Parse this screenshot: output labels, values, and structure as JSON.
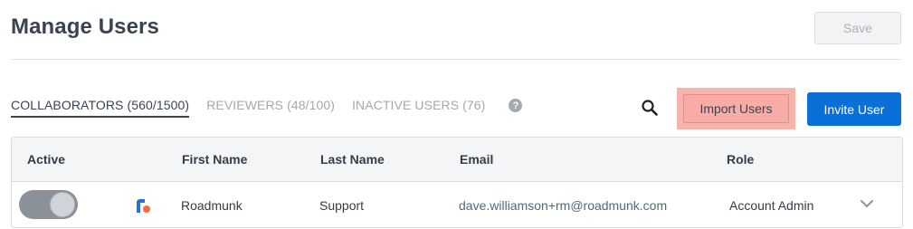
{
  "header": {
    "title": "Manage Users",
    "save_label": "Save"
  },
  "tabs": [
    {
      "label": "COLLABORATORS (560/1500)",
      "active": true
    },
    {
      "label": "REVIEWERS (48/100)",
      "active": false
    },
    {
      "label": "INACTIVE USERS (76)",
      "active": false
    }
  ],
  "help_icon": {
    "glyph": "?",
    "icon": "help-icon"
  },
  "actions": {
    "search_icon": "search-icon",
    "import_label": "Import Users",
    "invite_label": "Invite User"
  },
  "table": {
    "columns": [
      "Active",
      "First Name",
      "Last Name",
      "Email",
      "Role"
    ],
    "rows": [
      {
        "active": true,
        "logo_icon": "roadmunk-logo-icon",
        "first_name": "Roadmunk",
        "last_name": "Support",
        "email": "dave.williamson+rm@roadmunk.com",
        "role": "Account Admin"
      }
    ]
  },
  "colors": {
    "primary": "#0a6fd6",
    "highlight": "#f9aca5",
    "logo_blue": "#2a6fd8",
    "logo_orange": "#f26a3d"
  }
}
